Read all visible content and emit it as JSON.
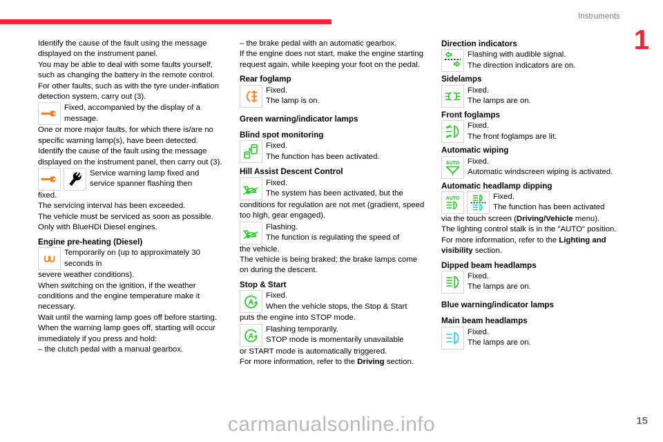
{
  "header": {
    "title": "Instruments",
    "chapter": "1"
  },
  "footer": {
    "watermark": "carmanualsonline.info",
    "page_number": "15"
  },
  "colors": {
    "accent_red": "#fc2230",
    "orange": "#f58220",
    "green": "#22c721",
    "cyan": "#18d5d5",
    "black": "#000000",
    "icon_border": "#d4d4d4"
  },
  "columns": {
    "left": {
      "paragraphs": {
        "p1": "Identify the cause of the fault using the message displayed on the instrument panel.",
        "p2": "You may be able to deal with some faults yourself, such as changing the battery in the remote control.",
        "p3": "For other faults, such as with the tyre under-inflation detection system, carry out (3).",
        "icon1_text_line1": "Fixed, accompanied by the display of a",
        "icon1_text_line2": "message.",
        "p4": "One or more major faults, for which there is/are no specific warning lamp(s), have been detected.",
        "p5": "Identify the cause of the fault using the message displayed on the instrument panel, then carry out (3).",
        "icon2_text": "Service warning lamp fixed and service spanner flashing then",
        "p6": "fixed.",
        "p7": "The servicing interval has been exceeded.",
        "p8": "The vehicle must be serviced as soon as possible.",
        "p9": "Only with BlueHDi Diesel engines.",
        "heading_engine_preheating": "Engine pre-heating (Diesel)",
        "icon3_line1": "Temporarily on",
        "icon3_line2": "(up to approximately 30 seconds in",
        "p10": "severe weather conditions).",
        "p11": "When switching on the ignition, if the weather conditions and the engine temperature make it necessary.",
        "p12": "Wait until the warning lamp goes off before starting.",
        "p13": "When the warning lamp goes off, starting will occur immediately if you press and hold:",
        "p14": "– the clutch pedal with a manual gearbox."
      }
    },
    "middle": {
      "p1": "–  the brake pedal with an automatic gearbox.",
      "p2": "If the engine does not start, make the engine starting request again, while keeping your foot on the pedal.",
      "heading_rear_foglamp": "Rear foglamp",
      "rear_foglamp_line1": "Fixed.",
      "rear_foglamp_line2": "The lamp is on.",
      "heading_green_lamps": "Green warning/indicator lamps",
      "heading_blind_spot": "Blind spot monitoring",
      "blind_spot_line1": "Fixed.",
      "blind_spot_line2": "The function has been activated.",
      "heading_hill_assist": "Hill Assist Descent Control",
      "hill_a_line1": "Fixed.",
      "hill_a_line2": "The system has been activated, but the",
      "hill_a_cont": "conditions for regulation are not met (gradient, speed too high, gear engaged).",
      "hill_b_line1": "Flashing.",
      "hill_b_line2": "The function is regulating the speed of",
      "hill_b_cont": "the vehicle.",
      "hill_b_cont2": "The vehicle is being braked; the brake lamps come on during the descent.",
      "heading_stop_start": "Stop & Start",
      "ss_a_line1": "Fixed.",
      "ss_a_line2": "When the vehicle stops, the Stop & Start",
      "ss_a_cont": "puts the engine into STOP mode.",
      "ss_b_line1": "Flashing temporarily.",
      "ss_b_line2": "STOP mode is momentarily unavailable",
      "ss_b_cont": "or START mode is automatically triggered.",
      "ss_more_pre": "For more information, refer to the ",
      "ss_more_bold": "Driving",
      "ss_more_post": " section."
    },
    "right": {
      "heading_direction": "Direction indicators",
      "direction_line1": "Flashing with audible signal.",
      "direction_line2": "The direction indicators are on.",
      "heading_sidelamps": "Sidelamps",
      "sidelamps_line1": "Fixed.",
      "sidelamps_line2": "The lamps are on.",
      "heading_front_foglamps": "Front foglamps",
      "front_foglamps_line1": "Fixed.",
      "front_foglamps_line2": "The front foglamps are lit.",
      "heading_auto_wiping": "Automatic wiping",
      "auto_wiping_line1": "Fixed.",
      "auto_wiping_line2": "Automatic windscreen wiping is activated.",
      "heading_auto_dipping": "Automatic headlamp dipping",
      "auto_dipping_line1": "Fixed.",
      "auto_dipping_line2": "The function has been activated",
      "auto_dipping_cont_pre": "via the touch screen (",
      "auto_dipping_cont_bold": "Driving/Vehicle",
      "auto_dipping_cont_post": " menu).",
      "auto_dipping_p2": "The lighting control stalk is in the \"AUTO\" position.",
      "auto_dipping_p3_pre": "For more information, refer to the ",
      "auto_dipping_p3_bold": "Lighting and visibility",
      "auto_dipping_p3_post": " section.",
      "heading_dipped_beam": "Dipped beam headlamps",
      "dipped_beam_line1": "Fixed.",
      "dipped_beam_line2": "The lamps are on.",
      "heading_blue_lamps": "Blue warning/indicator lamps",
      "heading_main_beam": "Main beam headlamps",
      "main_beam_line1": "Fixed.",
      "main_beam_line2": "The lamps are on."
    }
  },
  "icons": {
    "spanner_orange": "spanner-orange-icon",
    "spanner_black": "spanner-black-icon",
    "glow_plug": "glow-plug-icon",
    "rear_foglamp": "rear-foglamp-icon",
    "blind_spot": "blind-spot-icon",
    "hill_descent": "hill-descent-icon",
    "stop_start": "stop-start-icon",
    "direction_indicators": "direction-indicators-icon",
    "sidelamps": "sidelamps-icon",
    "front_foglamps": "front-foglamps-icon",
    "auto_wiping": "auto-wiping-icon",
    "auto_headlamp": "auto-headlamp-icon",
    "dipped_beam": "dipped-beam-icon",
    "main_beam": "main-beam-icon"
  }
}
